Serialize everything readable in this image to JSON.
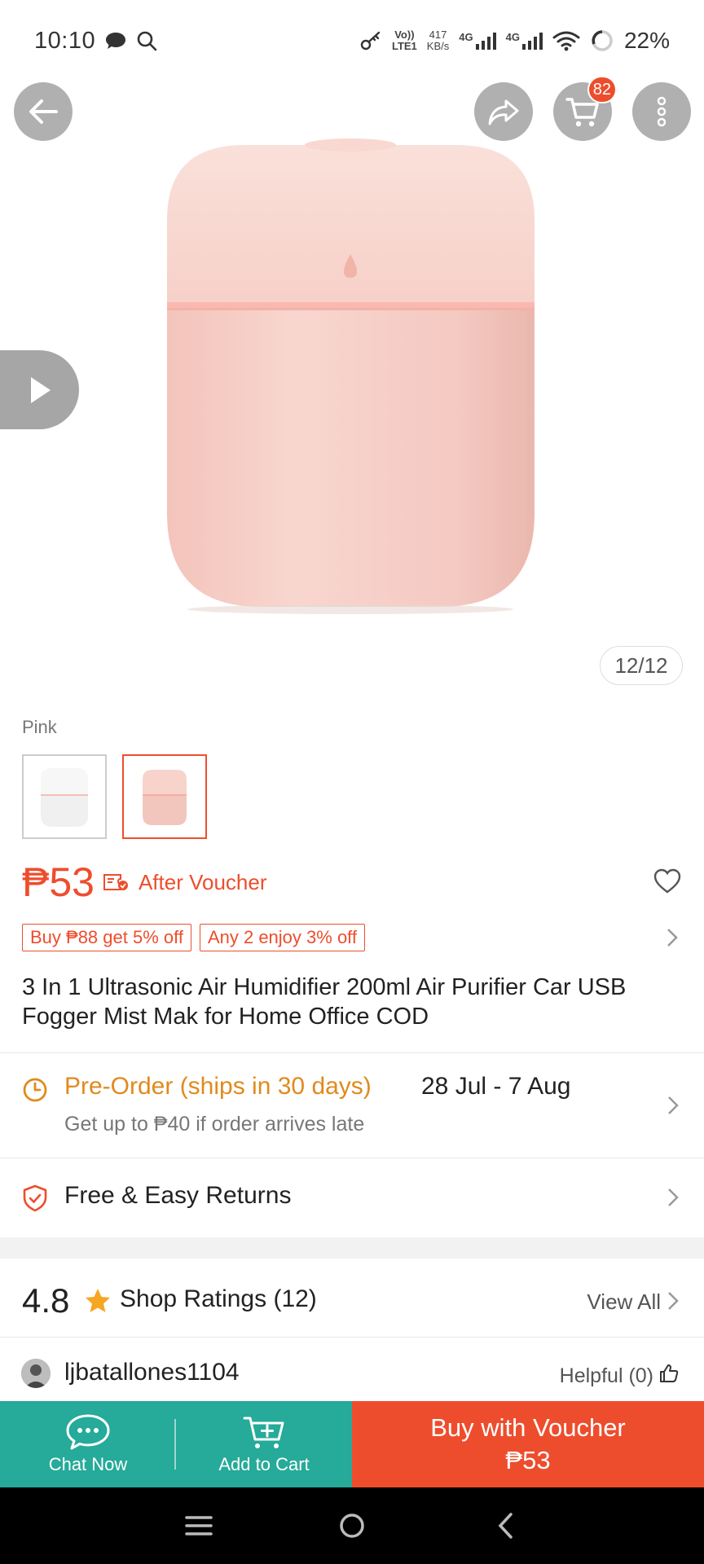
{
  "status_bar": {
    "time": "10:10",
    "network_top": "Vo))",
    "network_bottom": "LTE1",
    "speed_top": "417",
    "speed_bottom": "KB/s",
    "signal_1": "4G",
    "signal_2": "4G",
    "battery": "22%"
  },
  "gallery": {
    "counter": "12/12",
    "cart_count": "82",
    "product_color": "#f6cfc8"
  },
  "variation": {
    "label": "Pink",
    "options": [
      {
        "name": "white",
        "color": "#f2f2f2",
        "selected": false
      },
      {
        "name": "pink",
        "color": "#f5c9c0",
        "selected": true
      }
    ]
  },
  "price": {
    "amount": "₱53",
    "after_voucher": "After Voucher"
  },
  "promos": [
    "Buy ₱88 get 5% off",
    "Any 2 enjoy 3% off"
  ],
  "product_title": "3 In 1 Ultrasonic Air Humidifier 200ml Air Purifier Car USB Fogger Mist Mak for Home Office COD",
  "shipping": {
    "preorder_label": "Pre-Order (ships in 30 days)",
    "date_range": "28 Jul - 7 Aug",
    "late_note": "Get up to ₱40 if order arrives late"
  },
  "returns": {
    "label": "Free & Easy Returns"
  },
  "ratings": {
    "score": "4.8",
    "label": "Shop Ratings (12)",
    "view_all": "View All"
  },
  "review": {
    "username": "ljbatallones1104",
    "helpful": "Helpful (0)"
  },
  "actions": {
    "chat": "Chat Now",
    "add_to_cart": "Add to Cart",
    "buy_label": "Buy with Voucher",
    "buy_price": "₱53"
  },
  "colors": {
    "accent": "#ee4d2d",
    "green": "#26aa99",
    "preorder": "#e08a1e",
    "star": "#f5a623"
  }
}
